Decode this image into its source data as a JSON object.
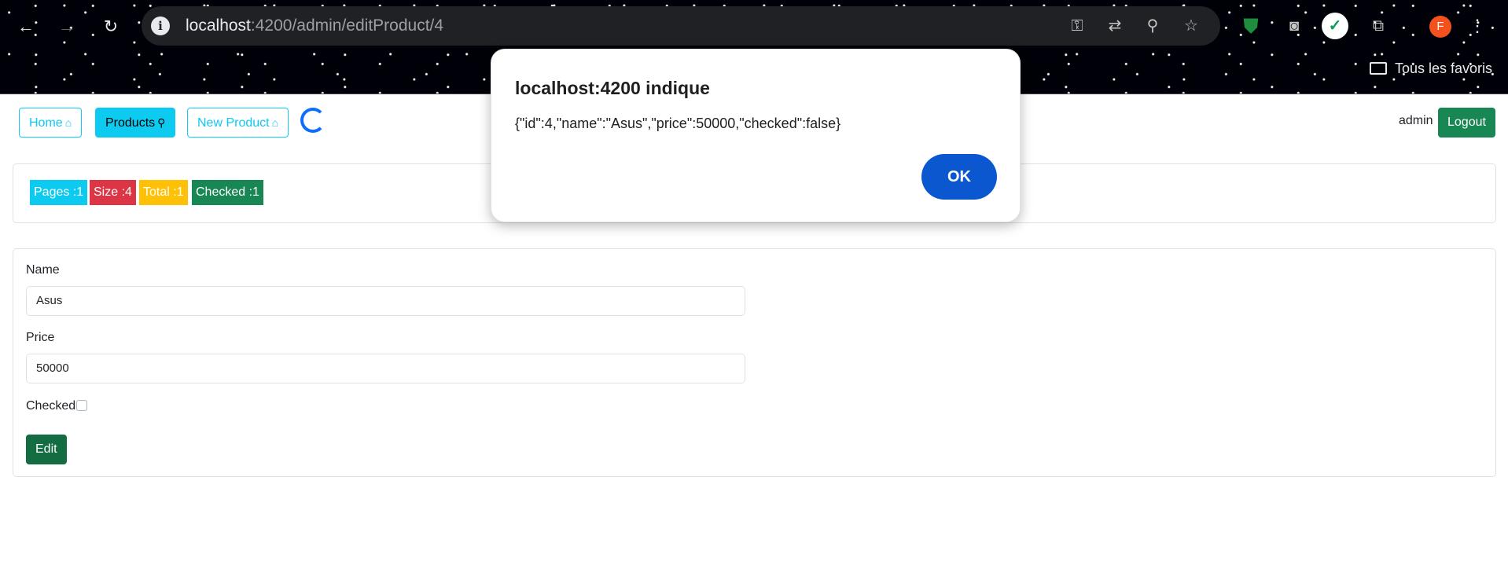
{
  "browser": {
    "url_host": "localhost",
    "url_path": ":4200/admin/editProduct/4",
    "back_icon": "arrow-left-icon",
    "forward_icon": "arrow-right-icon",
    "reload_icon": "reload-icon",
    "bookmarks_label": "Tous les favoris",
    "profile_initial": "F"
  },
  "nav": {
    "home_label": "Home",
    "products_label": "Products",
    "new_product_label": "New Product",
    "user_label": "admin",
    "logout_label": "Logout"
  },
  "badges": {
    "pages": "Pages :1",
    "size": "Size :4",
    "total": "Total :1",
    "checked": "Checked :1"
  },
  "form": {
    "name_label": "Name",
    "name_value": "Asus",
    "price_label": "Price",
    "price_value": "50000",
    "checked_label": "Checked",
    "checked_value": false,
    "submit_label": "Edit"
  },
  "alert": {
    "title": "localhost:4200 indique",
    "message": "{\"id\":4,\"name\":\"Asus\",\"price\":50000,\"checked\":false}",
    "ok_label": "OK"
  }
}
